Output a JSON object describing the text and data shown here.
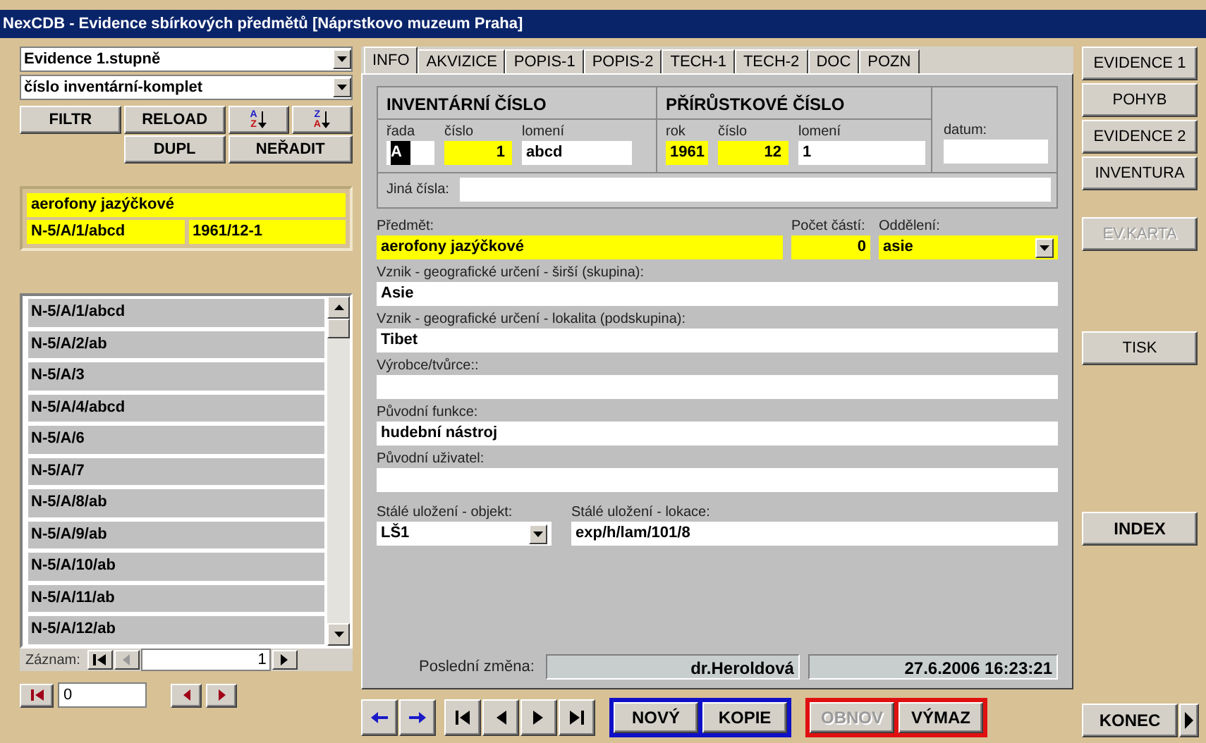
{
  "window": {
    "title": "NexCDB - Evidence sbírkových předmětů [Náprstkovo muzeum Praha]"
  },
  "left": {
    "dropdowns": [
      {
        "value": "Evidence 1.stupně"
      },
      {
        "value": "číslo inventární-komplet"
      }
    ],
    "buttons": [
      {
        "kind": "text",
        "label": "FILTR"
      },
      {
        "kind": "text",
        "label": "RELOAD"
      },
      {
        "kind": "sort",
        "top": "A",
        "bottom": "Z"
      },
      {
        "kind": "sort",
        "top": "Z",
        "bottom": "A"
      },
      {
        "kind": "spacer"
      },
      {
        "kind": "text",
        "label": "DUPL"
      },
      {
        "kind": "text",
        "label": "NEŘADIT"
      }
    ],
    "summary": {
      "subject": "aerofony jazýčkové",
      "inventory": "N-5/A/1/abcd",
      "accession": "1961/12-1"
    },
    "list": [
      "N-5/A/1/abcd",
      "N-5/A/2/ab",
      "N-5/A/3",
      "N-5/A/4/abcd",
      "N-5/A/6",
      "N-5/A/7",
      "N-5/A/8/ab",
      "N-5/A/9/ab",
      "N-5/A/10/ab",
      "N-5/A/11/ab",
      "N-5/A/12/ab"
    ],
    "record_nav": {
      "label": "Záznam:",
      "value": "1"
    },
    "bottom_field": {
      "value": "0"
    }
  },
  "tabs": [
    {
      "label": "INFO",
      "selected": true
    },
    {
      "label": "AKVIZICE",
      "selected": false
    },
    {
      "label": "POPIS-1",
      "selected": false
    },
    {
      "label": "POPIS-2",
      "selected": false
    },
    {
      "label": "TECH-1",
      "selected": false
    },
    {
      "label": "TECH-2",
      "selected": false
    },
    {
      "label": "DOC",
      "selected": false
    },
    {
      "label": "POZN",
      "selected": false
    }
  ],
  "numbers": [
    {
      "heading": "INVENTÁRNÍ ČÍSLO",
      "fields": [
        {
          "label": "řada",
          "value": "A",
          "required": false,
          "text_selected": true,
          "kind": "text"
        },
        {
          "label": "číslo",
          "value": "1",
          "required": true,
          "kind": "number"
        },
        {
          "label": "lomení",
          "value": "abcd",
          "required": false,
          "kind": "text"
        }
      ]
    },
    {
      "heading": "PŘÍRŮSTKOVÉ ČÍSLO",
      "fields": [
        {
          "label": "rok",
          "value": "1961",
          "required": true,
          "kind": "text"
        },
        {
          "label": "číslo",
          "value": "12",
          "required": true,
          "kind": "number"
        },
        {
          "label": "lomení",
          "value": "1",
          "required": false,
          "kind": "text"
        }
      ]
    }
  ],
  "date_field": {
    "label": "datum:"
  },
  "other_numbers": {
    "label": "Jiná čísla:"
  },
  "subject_row": [
    {
      "label": "Předmět:",
      "value": "aerofony jazýčkové",
      "required": true,
      "kind": "text"
    },
    {
      "label": "Počet částí:",
      "value": "0",
      "required": true,
      "kind": "number"
    },
    {
      "label": "Oddělení:",
      "value": "asie",
      "required": true,
      "kind": "dropdown"
    }
  ],
  "rows": [
    {
      "label": "Vznik - geografické určení - širší (skupina):",
      "value": "Asie"
    },
    {
      "label": "Vznik - geografické určení - lokalita (podskupina):",
      "value": "Tibet"
    },
    {
      "label": "Výrobce/tvůrce::"
    },
    {
      "label": "Původní funkce:",
      "value": "hudební nástroj"
    },
    {
      "label": "Původní uživatel:"
    }
  ],
  "storage": [
    {
      "label": "Stálé uložení - objekt:",
      "value": "LŠ1",
      "kind": "dropdown"
    },
    {
      "label": "Stálé uložení - lokace:",
      "value": "exp/h/lam/101/8",
      "kind": "text"
    }
  ],
  "last_change": {
    "label": "Poslední změna:",
    "user": "dr.Heroldová",
    "time": "27.6.2006 16:23:21"
  },
  "nav": [
    {
      "kind": "back"
    },
    {
      "kind": "forward"
    },
    {
      "kind": "first"
    },
    {
      "kind": "prev"
    },
    {
      "kind": "next"
    },
    {
      "kind": "last"
    }
  ],
  "action_groups": [
    {
      "color": "#1010c8",
      "buttons": [
        {
          "label": "NOVÝ",
          "disabled": false
        },
        {
          "label": "KOPIE",
          "disabled": false
        }
      ]
    },
    {
      "color": "#e01010",
      "buttons": [
        {
          "label": "OBNOV",
          "disabled": true
        },
        {
          "label": "VÝMAZ",
          "disabled": false
        }
      ]
    }
  ],
  "right": [
    {
      "label": "EVIDENCE 1",
      "disabled": false,
      "bold": false
    },
    {
      "label": "POHYB",
      "disabled": false,
      "bold": false
    },
    {
      "label": "EVIDENCE 2",
      "disabled": false,
      "bold": false
    },
    {
      "label": "INVENTURA",
      "disabled": false,
      "bold": false
    },
    {
      "label": "EV.KARTA",
      "disabled": true,
      "bold": false
    },
    {
      "label": "TISK",
      "disabled": false,
      "bold": false
    },
    {
      "label": "INDEX",
      "disabled": false,
      "bold": true
    }
  ],
  "exit": {
    "label": "KONEC"
  }
}
